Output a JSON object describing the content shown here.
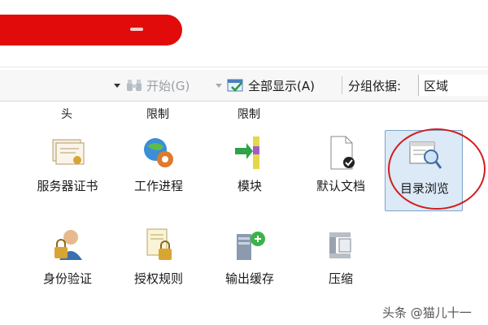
{
  "toolbar": {
    "start_label": "开始(G)",
    "show_all_label": "全部显示(A)",
    "group_by_label": "分组依据:",
    "group_by_value": "区域",
    "icons": [
      "binoculars-icon",
      "show-all-icon"
    ]
  },
  "section_labels": [
    "头",
    "限制",
    "限制"
  ],
  "features_row1": [
    {
      "label": "服务器证书",
      "icon": "server-certificate-icon"
    },
    {
      "label": "工作进程",
      "icon": "worker-process-icon"
    },
    {
      "label": "模块",
      "icon": "modules-icon"
    },
    {
      "label": "默认文档",
      "icon": "default-document-icon"
    },
    {
      "label": "目录浏览",
      "icon": "directory-browsing-icon",
      "selected": true
    }
  ],
  "features_row2": [
    {
      "label": "身份验证",
      "icon": "authentication-icon"
    },
    {
      "label": "授权规则",
      "icon": "authorization-rules-icon"
    },
    {
      "label": "输出缓存",
      "icon": "output-caching-icon"
    },
    {
      "label": "压缩",
      "icon": "compression-icon"
    }
  ],
  "watermark": "头条 @猫儿十一",
  "colors": {
    "highlight_circle": "#d21d1d",
    "selected_bg": "#dce9f6",
    "redaction": "#e10b0b"
  }
}
